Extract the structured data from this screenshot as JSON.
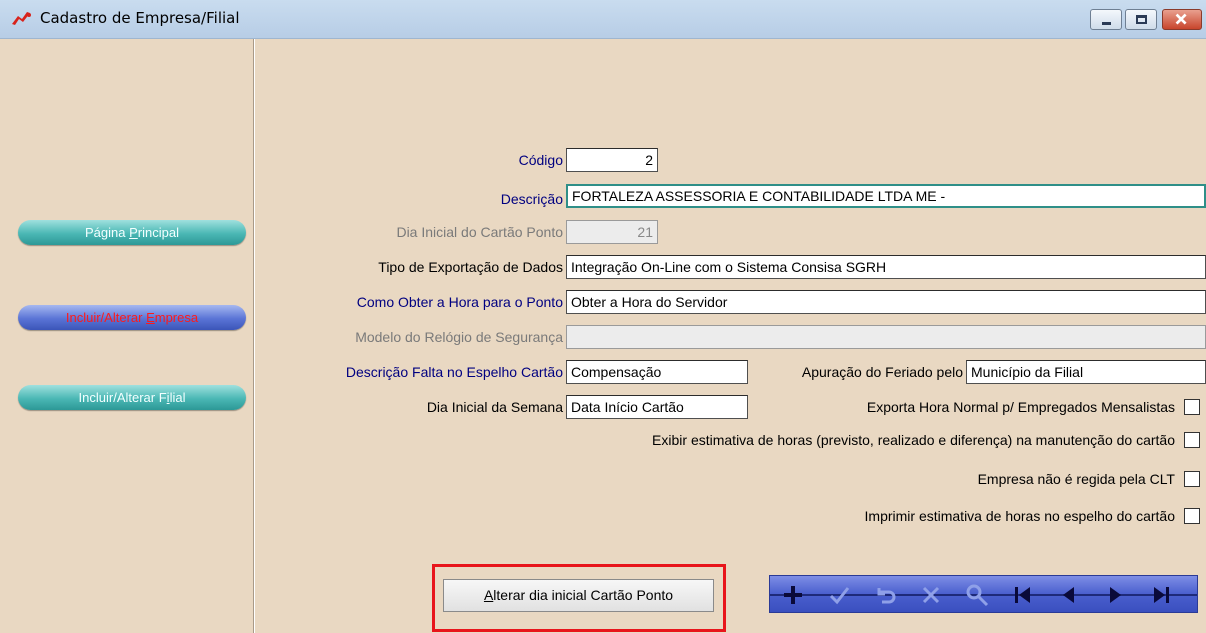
{
  "window": {
    "title": "Cadastro de Empresa/Filial"
  },
  "sidebar": {
    "btn_principal": {
      "pre": "Página ",
      "key": "P",
      "post": "rincipal"
    },
    "btn_empresa": {
      "pre": "Incluir/Alterar ",
      "key": "E",
      "post": "mpresa"
    },
    "btn_filial": {
      "pre": "Incluir/Alterar F",
      "key": "i",
      "post": "lial"
    }
  },
  "form": {
    "codigo_label": "Código",
    "codigo_value": "2",
    "descricao_label": "Descrição",
    "descricao_value": "FORTALEZA ASSESSORIA E CONTABILIDADE LTDA ME -",
    "dia_inicial_label": "Dia Inicial do Cartão Ponto",
    "dia_inicial_value": "21",
    "tipo_exportacao_label": "Tipo de Exportação de Dados",
    "tipo_exportacao_value": "Integração On-Line com o Sistema Consisa SGRH",
    "obter_hora_label": "Como Obter a Hora para o Ponto",
    "obter_hora_value": "Obter a Hora do Servidor",
    "modelo_relogio_label": "Modelo do Relógio de Segurança",
    "modelo_relogio_value": "",
    "descricao_falta_label": "Descrição Falta no Espelho Cartão",
    "descricao_falta_value": "Compensação",
    "apuracao_feriado_label": "Apuração do Feriado pelo",
    "apuracao_feriado_value": "Município da Filial",
    "dia_semana_label": "Dia Inicial da Semana",
    "dia_semana_value": "Data Início Cartão",
    "exporta_hora_label": "Exporta Hora Normal p/ Empregados Mensalistas",
    "exibir_estimativa_label": "Exibir estimativa de horas (previsto, realizado e diferença) na manutenção do cartão",
    "empresa_clt_label": "Empresa não é regida pela CLT",
    "imprimir_estimativa_label": "Imprimir estimativa de horas no espelho do cartão"
  },
  "actions": {
    "alterar_pre": "",
    "alterar_key": "A",
    "alterar_post": "lterar dia inicial Cartão Ponto"
  },
  "navigator": {
    "icons": [
      "plus-icon",
      "check-icon",
      "undo-icon",
      "delete-icon",
      "search-icon",
      "first-icon",
      "prior-icon",
      "next-icon",
      "last-icon"
    ]
  },
  "colors": {
    "background": "#e9d8c2",
    "teal": "#2f8f88",
    "label_blue": "#000080",
    "accent_red": "#e8151b"
  }
}
